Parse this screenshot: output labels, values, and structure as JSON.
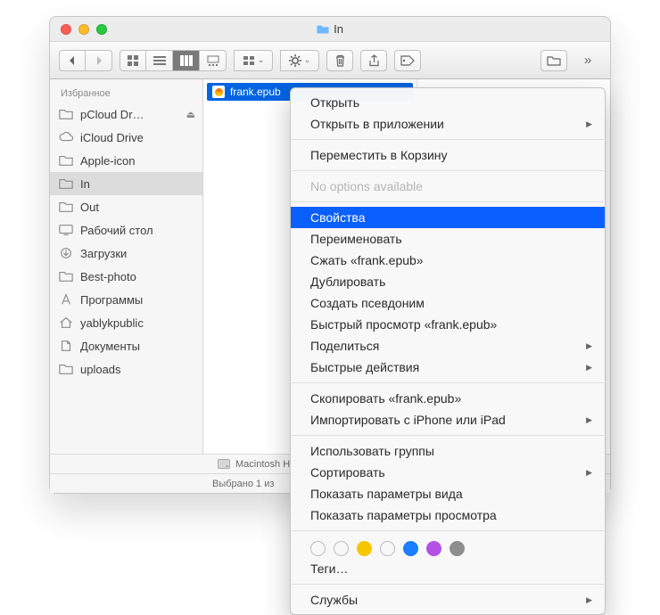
{
  "window": {
    "title": "In"
  },
  "sidebar": {
    "header": "Избранное",
    "items": [
      {
        "label": "pCloud Dr…",
        "icon": "folder",
        "eject": true
      },
      {
        "label": "iCloud Drive",
        "icon": "cloud"
      },
      {
        "label": "Apple-icon",
        "icon": "folder"
      },
      {
        "label": "In",
        "icon": "folder",
        "selected": true
      },
      {
        "label": "Out",
        "icon": "folder"
      },
      {
        "label": "Рабочий стол",
        "icon": "desktop"
      },
      {
        "label": "Загрузки",
        "icon": "downloads"
      },
      {
        "label": "Best-photo",
        "icon": "folder"
      },
      {
        "label": "Программы",
        "icon": "apps"
      },
      {
        "label": "yablykpublic",
        "icon": "home"
      },
      {
        "label": "Документы",
        "icon": "docs"
      },
      {
        "label": "uploads",
        "icon": "folder"
      }
    ]
  },
  "column": {
    "file": "frank.epub"
  },
  "pathbar": {
    "root": "Macintosh HD"
  },
  "status": {
    "text": "Выбрано 1 из"
  },
  "menu": {
    "groups": [
      [
        {
          "label": "Открыть"
        },
        {
          "label": "Открыть в приложении",
          "submenu": true
        }
      ],
      [
        {
          "label": "Переместить в Корзину"
        }
      ],
      [
        {
          "label": "No options available",
          "disabled": true
        }
      ],
      [
        {
          "label": "Свойства",
          "highlight": true
        },
        {
          "label": "Переименовать"
        },
        {
          "label": "Сжать «frank.epub»"
        },
        {
          "label": "Дублировать"
        },
        {
          "label": "Создать псевдоним"
        },
        {
          "label": "Быстрый просмотр «frank.epub»"
        },
        {
          "label": "Поделиться",
          "submenu": true
        },
        {
          "label": "Быстрые действия",
          "submenu": true
        }
      ],
      [
        {
          "label": "Скопировать «frank.epub»"
        },
        {
          "label": "Импортировать с iPhone или iPad",
          "submenu": true
        }
      ],
      [
        {
          "label": "Использовать группы"
        },
        {
          "label": "Сортировать",
          "submenu": true
        },
        {
          "label": "Показать параметры вида"
        },
        {
          "label": "Показать параметры просмотра"
        }
      ]
    ],
    "tags_label": "Теги…",
    "tag_colors": [
      "",
      "",
      "#f7c600",
      "",
      "#1b7dff",
      "#b450e6",
      "#8e8e8e"
    ],
    "services": "Службы"
  }
}
